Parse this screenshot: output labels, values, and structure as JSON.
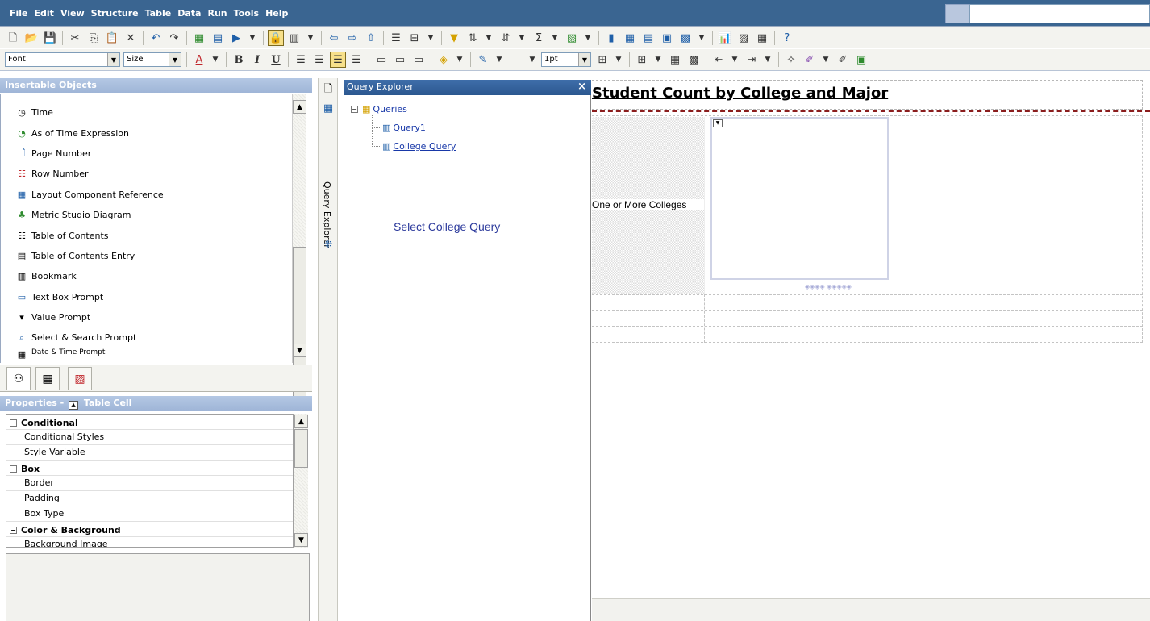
{
  "menubar": {
    "items": [
      "File",
      "Edit",
      "View",
      "Structure",
      "Table",
      "Data",
      "Run",
      "Tools",
      "Help"
    ]
  },
  "format_toolbar": {
    "font_value": "Font",
    "size_value": "Size",
    "line_weight_value": "1pt"
  },
  "insertable_objects": {
    "title": "Insertable Objects",
    "items": [
      {
        "label": "Time",
        "icon": "clock-icon"
      },
      {
        "label": "As of Time Expression",
        "icon": "time-expression-icon"
      },
      {
        "label": "Page Number",
        "icon": "page-number-icon"
      },
      {
        "label": "Row Number",
        "icon": "row-number-icon"
      },
      {
        "label": "Layout Component Reference",
        "icon": "layout-reference-icon"
      },
      {
        "label": "Metric Studio Diagram",
        "icon": "metric-diagram-icon"
      },
      {
        "label": "Table of Contents",
        "icon": "toc-icon"
      },
      {
        "label": "Table of Contents Entry",
        "icon": "toc-entry-icon"
      },
      {
        "label": "Bookmark",
        "icon": "bookmark-icon"
      },
      {
        "label": "Text Box Prompt",
        "icon": "text-box-prompt-icon"
      },
      {
        "label": "Value Prompt",
        "icon": "value-prompt-icon"
      },
      {
        "label": "Select & Search Prompt",
        "icon": "select-search-prompt-icon"
      },
      {
        "label": "Date & Time Prompt",
        "icon": "date-time-prompt-icon"
      }
    ]
  },
  "properties": {
    "title": "Properties - ",
    "object": "Table Cell",
    "rows": [
      {
        "label": "Conditional",
        "category": true
      },
      {
        "label": "Conditional Styles",
        "category": false
      },
      {
        "label": "Style Variable",
        "category": false
      },
      {
        "label": "Box",
        "category": true
      },
      {
        "label": "Border",
        "category": false
      },
      {
        "label": "Padding",
        "category": false
      },
      {
        "label": "Box Type",
        "category": false
      },
      {
        "label": "Color & Background",
        "category": true
      },
      {
        "label": "Background Image",
        "category": false
      }
    ]
  },
  "side_tabs": {
    "query_explorer_label": "Query Explorer"
  },
  "query_explorer": {
    "title": "Query Explorer",
    "close": "×",
    "root": "Queries",
    "queries": [
      "Query1",
      "College Query"
    ],
    "hint": "Select College Query"
  },
  "report": {
    "title": "Student Count by College and Major",
    "prompt_text": "One or More Colleges",
    "list_dots": "◈◈◈◈ ◈◈◈◈◈"
  },
  "colors": {
    "menubar": "#3a6591",
    "panel_header": "#a6bbdc",
    "query_explorer_header": "#2b578f",
    "title_separator": "#8b1d1d",
    "link": "#1838a8"
  }
}
